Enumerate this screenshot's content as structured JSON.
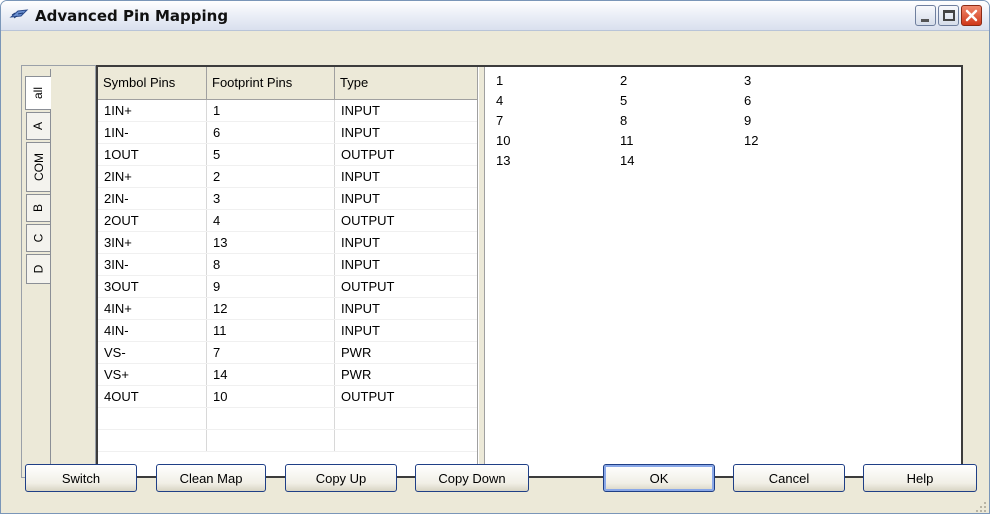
{
  "window": {
    "title": "Advanced Pin Mapping",
    "icon": "chip-icon"
  },
  "tabs": [
    {
      "label": "all",
      "active": true
    },
    {
      "label": "A",
      "active": false
    },
    {
      "label": "COM",
      "active": false
    },
    {
      "label": "B",
      "active": false
    },
    {
      "label": "C",
      "active": false
    },
    {
      "label": "D",
      "active": false
    }
  ],
  "grid": {
    "headers": [
      "Symbol Pins",
      "Footprint Pins",
      "Type"
    ],
    "rows": [
      [
        "1IN+",
        "1",
        "INPUT"
      ],
      [
        "1IN-",
        "6",
        "INPUT"
      ],
      [
        "1OUT",
        "5",
        "OUTPUT"
      ],
      [
        "2IN+",
        "2",
        "INPUT"
      ],
      [
        "2IN-",
        "3",
        "INPUT"
      ],
      [
        "2OUT",
        "4",
        "OUTPUT"
      ],
      [
        "3IN+",
        "13",
        "INPUT"
      ],
      [
        "3IN-",
        "8",
        "INPUT"
      ],
      [
        "3OUT",
        "9",
        "OUTPUT"
      ],
      [
        "4IN+",
        "12",
        "INPUT"
      ],
      [
        "4IN-",
        "11",
        "INPUT"
      ],
      [
        "VS-",
        "7",
        "PWR"
      ],
      [
        "VS+",
        "14",
        "PWR"
      ],
      [
        "4OUT",
        "10",
        "OUTPUT"
      ],
      [
        "",
        "",
        ""
      ],
      [
        "",
        "",
        ""
      ]
    ]
  },
  "footprint_pads": [
    "1",
    "2",
    "3",
    "4",
    "5",
    "6",
    "7",
    "8",
    "9",
    "10",
    "11",
    "12",
    "13",
    "14"
  ],
  "buttons": {
    "switch": "Switch",
    "clean_map": "Clean Map",
    "copy_up": "Copy Up",
    "copy_down": "Copy Down",
    "ok": "OK",
    "cancel": "Cancel",
    "help": "Help"
  },
  "colors": {
    "dialog_bg": "#ece9d8",
    "close_button": "#d0381a",
    "button_border": "#1f3f86"
  }
}
